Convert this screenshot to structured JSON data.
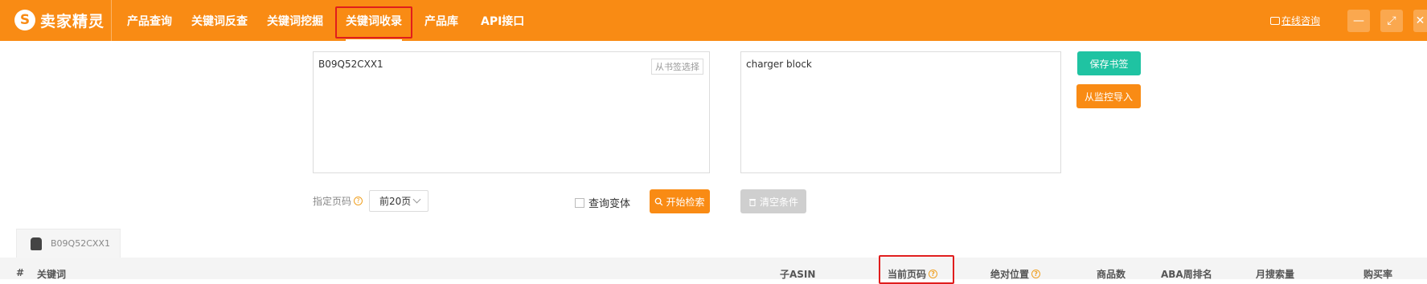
{
  "app": {
    "logo_text": "卖家精灵",
    "logo_glyph": "S"
  },
  "nav": {
    "items": [
      {
        "label": "产品查询"
      },
      {
        "label": "关键词反查"
      },
      {
        "label": "关键词挖掘"
      },
      {
        "label": "关键词收录",
        "active": true
      },
      {
        "label": "产品库"
      },
      {
        "label": "API接口"
      }
    ]
  },
  "header": {
    "consult_label": "在线咨询",
    "minimize_icon": "—",
    "maximize_icon": "⤢",
    "close_icon": "✕"
  },
  "search": {
    "asin_input_value": "B09Q52CXX1",
    "pick_bookmark_label": "从书签选择",
    "keyword_input_value": "charger block",
    "save_bookmark_label": "保存书签",
    "import_monitor_label": "从监控导入",
    "page_label": "指定页码",
    "page_select_value": "前20页",
    "variant_label": "查询变体",
    "search_button_label": "开始检索",
    "clear_button_label": "清空条件"
  },
  "result_tab": {
    "asin": "B09Q52CXX1"
  },
  "table": {
    "headers": [
      "#",
      "关键词",
      "子ASIN",
      "当前页码",
      "绝对位置",
      "商品数",
      "ABA周排名",
      "月搜索量",
      "购买率"
    ]
  },
  "colors": {
    "brand_orange": "#f98b14",
    "teal": "#1fc3a2",
    "highlight_red": "#e01d1d"
  }
}
